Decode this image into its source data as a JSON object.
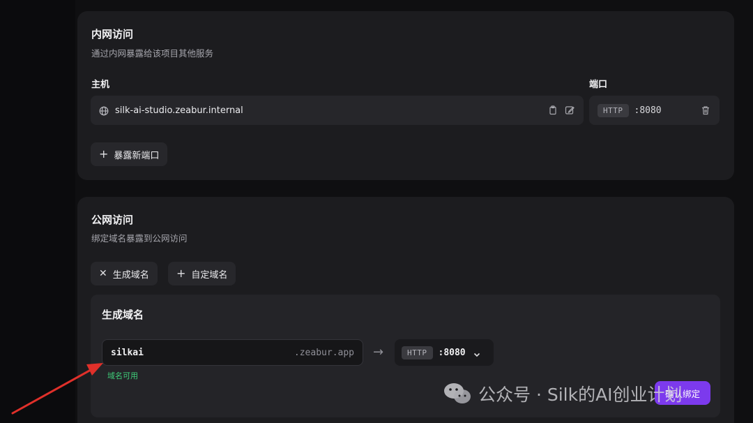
{
  "internal": {
    "title": "内网访问",
    "subtitle": "通过内网暴露给该项目其他服务",
    "host_label": "主机",
    "host_value": "silk-ai-studio.zeabur.internal",
    "port_label": "端口",
    "port_protocol": "HTTP",
    "port_value": ":8080",
    "expose_button": "暴露新端口"
  },
  "public": {
    "title": "公网访问",
    "subtitle": "绑定域名暴露到公网访问",
    "generate_button": "生成域名",
    "custom_button": "自定域名",
    "generated": {
      "title": "生成域名",
      "domain_value": "silkai",
      "domain_suffix": ".zeabur.app",
      "protocol": "HTTP",
      "port": ":8080",
      "availability": "域名可用",
      "confirm_button": "确认绑定"
    }
  },
  "watermark": {
    "text": "公众号 · Silk的AI创业计划"
  },
  "colors": {
    "accent": "#7c3aed",
    "success": "#3fcf7a",
    "arrow": "#e0302a"
  },
  "icons": [
    "globe-icon",
    "copy-icon",
    "edit-icon",
    "trash-icon",
    "plus-icon",
    "close-icon",
    "arrow-right-icon",
    "chevron-down-icon"
  ]
}
